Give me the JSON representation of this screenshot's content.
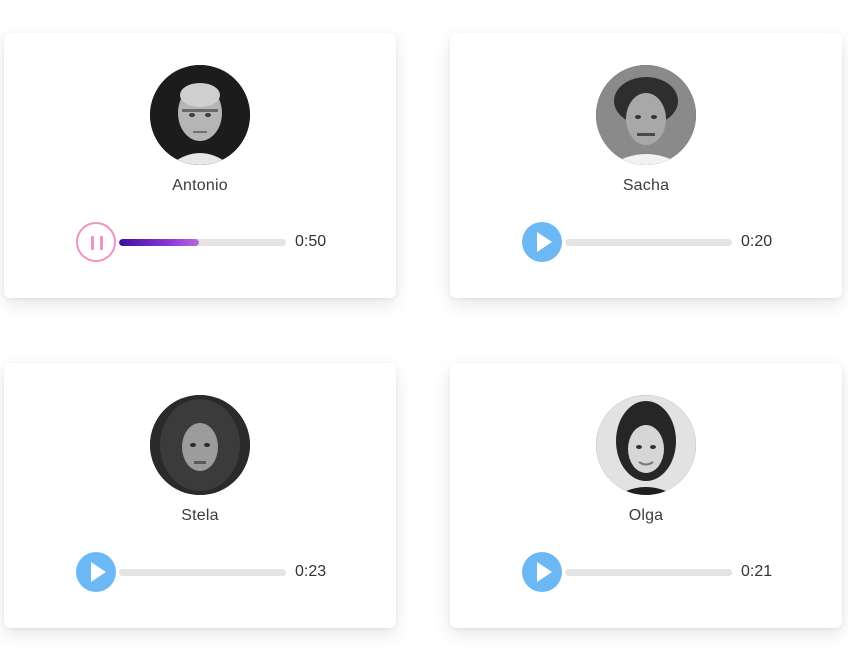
{
  "players": [
    {
      "name": "Antonio",
      "time": "0:50",
      "state": "playing",
      "progress": 0.48,
      "avatar_icon": "portrait-antonio"
    },
    {
      "name": "Sacha",
      "time": "0:20",
      "state": "paused",
      "progress": 0,
      "avatar_icon": "portrait-sacha"
    },
    {
      "name": "Stela",
      "time": "0:23",
      "state": "paused",
      "progress": 0,
      "avatar_icon": "portrait-stela"
    },
    {
      "name": "Olga",
      "time": "0:21",
      "state": "paused",
      "progress": 0,
      "avatar_icon": "portrait-olga"
    }
  ],
  "colors": {
    "play_button": "#6cb8f5",
    "pause_ring": "#ef93c2",
    "progress_start": "#3c12a0",
    "progress_end": "#b86ae0",
    "track": "#e4e4e4"
  }
}
